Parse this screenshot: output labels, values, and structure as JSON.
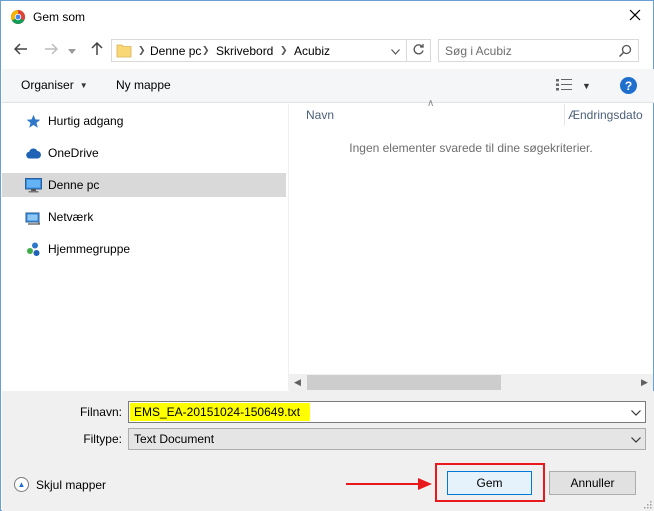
{
  "window": {
    "title": "Gem som",
    "app_icon": "chrome-icon",
    "close_icon": "close-icon"
  },
  "address_bar": {
    "segments": [
      "Denne pc",
      "Skrivebord",
      "Acubiz"
    ],
    "icons": {
      "back": "back-arrow-icon",
      "forward": "forward-arrow-icon",
      "recent": "recent-locations-icon",
      "up": "up-arrow-icon",
      "folder": "folder-icon",
      "refresh": "refresh-icon"
    }
  },
  "search": {
    "placeholder": "Søg i Acubiz",
    "icon": "search-icon"
  },
  "toolbar": {
    "organize_label": "Organiser",
    "new_folder_label": "Ny mappe",
    "view_icon": "view-options-icon",
    "help_label": "?"
  },
  "nav": {
    "items": [
      {
        "label": "Hurtig adgang",
        "icon": "star-icon",
        "selected": false
      },
      {
        "label": "OneDrive",
        "icon": "cloud-icon",
        "selected": false
      },
      {
        "label": "Denne pc",
        "icon": "computer-icon",
        "selected": true
      },
      {
        "label": "Netværk",
        "icon": "network-icon",
        "selected": false
      },
      {
        "label": "Hjemmegruppe",
        "icon": "homegroup-icon",
        "selected": false
      }
    ]
  },
  "file_list": {
    "columns": [
      "Navn",
      "Ændringsdato"
    ],
    "empty_message": "Ingen elementer svarede til dine søgekriterier."
  },
  "form": {
    "filename_label": "Filnavn:",
    "filename_value": "EMS_EA-20151024-150649.txt",
    "filetype_label": "Filtype:",
    "filetype_value": "Text Document"
  },
  "footer": {
    "hide_folders_label": "Skjul mapper",
    "save_label": "Gem",
    "cancel_label": "Annuller"
  },
  "colors": {
    "accent": "#0078d7",
    "highlight": "#ffff00",
    "annotation_red": "#e8181d",
    "selected_nav": "#d9d9d9"
  }
}
